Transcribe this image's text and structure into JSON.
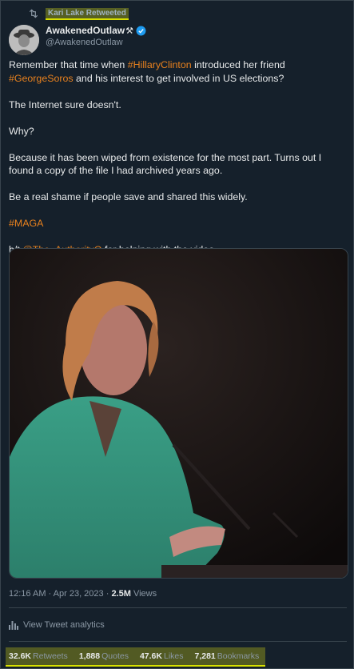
{
  "retweet": {
    "label": "Kari Lake Retweeted",
    "icon": "retweet-icon"
  },
  "author": {
    "name": "AwakenedOutlaw",
    "name_emoji": "⚒",
    "handle": "@AwakenedOutlaw",
    "verified_icon": "verified-badge-icon"
  },
  "tweet": {
    "p1_a": "Remember that time when ",
    "p1_hashtag1": "#HillaryClinton",
    "p1_b": " introduced her friend ",
    "p1_hashtag2": "#GeorgeSoros",
    "p1_c": " and his interest to get involved in US elections?",
    "p2": "The Internet sure doesn't.",
    "p3": "Why?",
    "p4": "Because it has been wiped from existence for the most part.  Turns out I found a copy of the file I had archived years ago.",
    "p5": "Be a real shame if people save and shared this widely.",
    "p6_hashtag": "#MAGA",
    "p7_a": "h/t ",
    "p7_mention": "@The_AuthorityQ",
    "p7_b": " for helping with the video"
  },
  "meta": {
    "time": "12:16 AM",
    "sep1": " · ",
    "date": "Apr 23, 2023",
    "sep2": " · ",
    "views_count": "2.5M",
    "views_label": " Views"
  },
  "analytics": {
    "label": "View Tweet analytics",
    "icon": "analytics-bar-icon"
  },
  "stats": [
    {
      "count": "32.6K",
      "label": "Retweets"
    },
    {
      "count": "1,888",
      "label": "Quotes"
    },
    {
      "count": "47.6K",
      "label": "Likes"
    },
    {
      "count": "7,281",
      "label": "Bookmarks"
    }
  ],
  "colors": {
    "background": "#15202b",
    "link": "#e8811e",
    "highlight": "#d7e000",
    "verified": "#1d9bf0"
  }
}
